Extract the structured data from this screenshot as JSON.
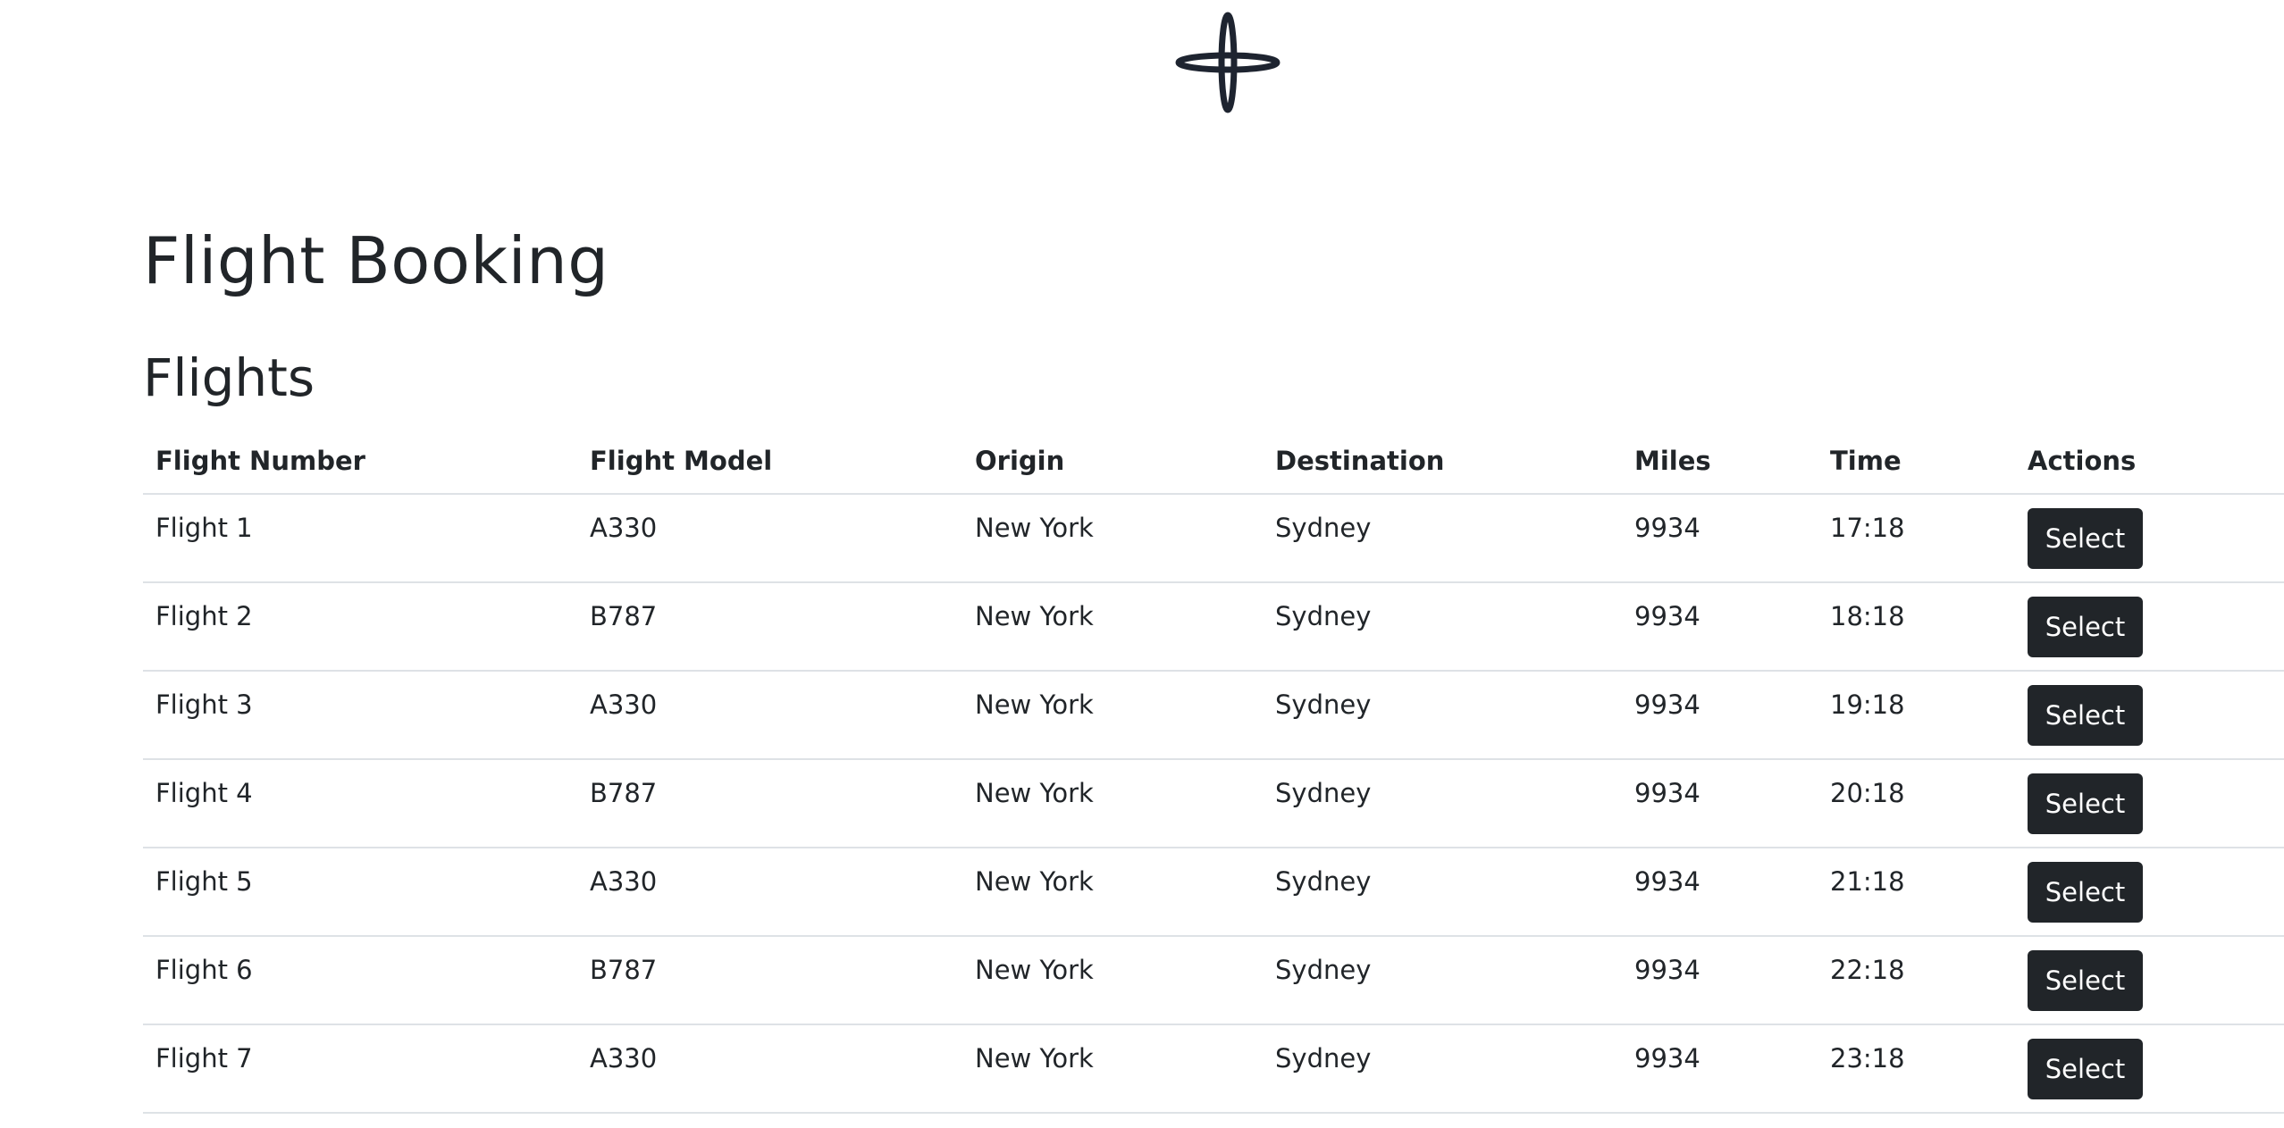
{
  "header": {
    "logo_icon": "four-point-star-icon"
  },
  "page": {
    "title": "Flight Booking",
    "section_title": "Flights"
  },
  "table": {
    "columns": [
      "Flight Number",
      "Flight Model",
      "Origin",
      "Destination",
      "Miles",
      "Time",
      "Actions"
    ],
    "rows": [
      {
        "flight_number": "Flight 1",
        "model": "A330",
        "origin": "New York",
        "destination": "Sydney",
        "miles": "9934",
        "time": "17:18",
        "action": "Select"
      },
      {
        "flight_number": "Flight 2",
        "model": "B787",
        "origin": "New York",
        "destination": "Sydney",
        "miles": "9934",
        "time": "18:18",
        "action": "Select"
      },
      {
        "flight_number": "Flight 3",
        "model": "A330",
        "origin": "New York",
        "destination": "Sydney",
        "miles": "9934",
        "time": "19:18",
        "action": "Select"
      },
      {
        "flight_number": "Flight 4",
        "model": "B787",
        "origin": "New York",
        "destination": "Sydney",
        "miles": "9934",
        "time": "20:18",
        "action": "Select"
      },
      {
        "flight_number": "Flight 5",
        "model": "A330",
        "origin": "New York",
        "destination": "Sydney",
        "miles": "9934",
        "time": "21:18",
        "action": "Select"
      },
      {
        "flight_number": "Flight 6",
        "model": "B787",
        "origin": "New York",
        "destination": "Sydney",
        "miles": "9934",
        "time": "22:18",
        "action": "Select"
      },
      {
        "flight_number": "Flight 7",
        "model": "A330",
        "origin": "New York",
        "destination": "Sydney",
        "miles": "9934",
        "time": "23:18",
        "action": "Select"
      }
    ]
  },
  "colors": {
    "text": "#212529",
    "button_bg": "#212529",
    "button_text": "#ffffff",
    "row_border": "#dee2e6",
    "logo": "#1e2430"
  }
}
